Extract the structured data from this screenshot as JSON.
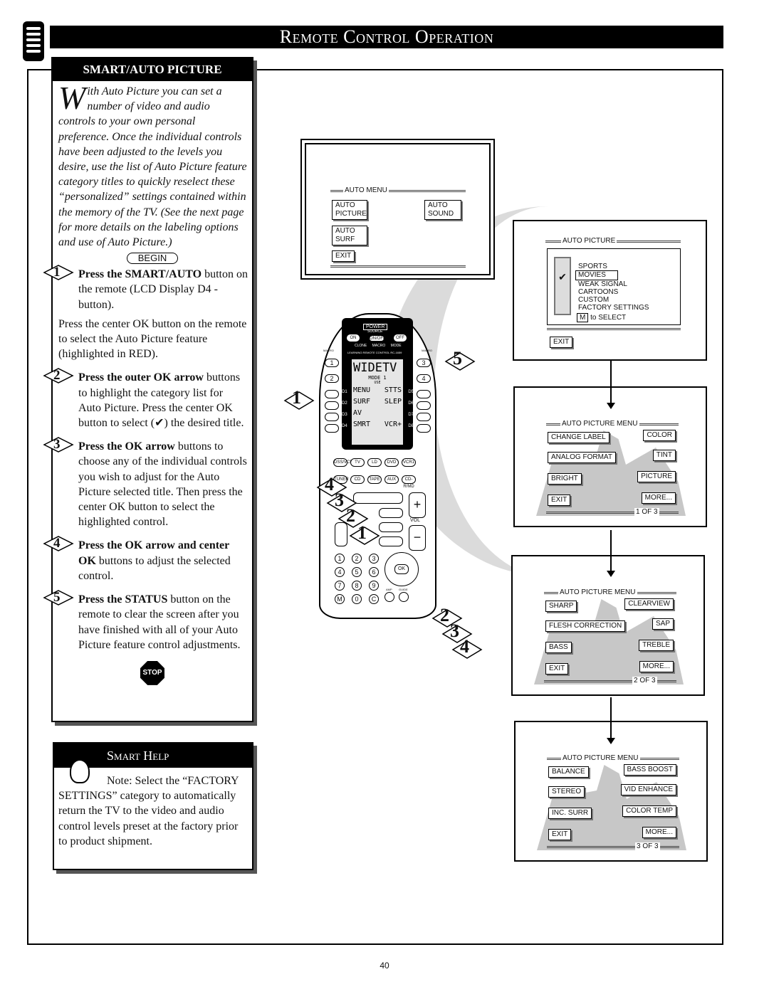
{
  "header": {
    "title": "Remote Control Operation"
  },
  "sidebar": {
    "heading": "SMART/AUTO PICTURE",
    "intro_dropcap": "W",
    "intro": "ith Auto Picture you can set a number of video and audio controls to your own personal preference. Once the individual controls have been adjusted to the levels you desire, use the list of Auto Picture feature category titles to quickly reselect these “personalized” settings contained within the memory of the TV. (See the next page for more details on the labeling options and use of Auto Picture.)",
    "begin": "BEGIN",
    "steps": [
      {
        "n": "1",
        "bold": "Press the SMART/AUTO",
        "rest": " button on the remote (LCD Display D4 - button).",
        "extra": "Press the center OK button on the remote to select the Auto Picture feature (highlighted in RED)."
      },
      {
        "n": "2",
        "bold": "Press the outer OK arrow",
        "rest": " buttons to highlight the category list for Auto Picture. Press the center OK button to select (✔) the desired title."
      },
      {
        "n": "3",
        "bold": "Press the OK arrow",
        "rest": " buttons to choose any of the individual controls you wish to adjust for the Auto Picture selected title. Then press the center OK button to select the highlighted control."
      },
      {
        "n": "4",
        "bold": "Press the OK arrow   and center OK",
        "rest": " buttons to adjust the selected control."
      },
      {
        "n": "5",
        "bold": "Press the STATUS",
        "rest": " button on the remote to clear the screen after you have finished with all of your Auto Picture feature control adjustments."
      }
    ],
    "stop": "STOP"
  },
  "smart_help": {
    "heading": "Smart Help",
    "note": "Note: Select the “FACTORY SETTINGS” category to automatically return the TV to the video and audio control levels preset at the factory prior to product shipment."
  },
  "screen1": {
    "title": "AUTO MENU",
    "items": [
      "AUTO PICTURE",
      "AUTO SOUND",
      "AUTO SURF",
      "EXIT"
    ]
  },
  "screen2": {
    "title": "AUTO PICTURE",
    "options": [
      "SPORTS",
      "MOVIES",
      "WEAK SIGNAL",
      "CARTOONS",
      "CUSTOM",
      "FACTORY SETTINGS"
    ],
    "selected": "MOVIES",
    "hint_key": "M",
    "hint": "to SELECT",
    "exit": "EXIT"
  },
  "menus": [
    {
      "title": "AUTO PICTURE MENU",
      "left": [
        "CHANGE LABEL",
        "ANALOG FORMAT",
        "BRIGHT",
        "EXIT"
      ],
      "right": [
        "COLOR",
        "TINT",
        "PICTURE",
        "MORE..."
      ],
      "page": "1  OF  3"
    },
    {
      "title": "AUTO PICTURE MENU",
      "left": [
        "SHARP",
        "FLESH CORRECTION",
        "BASS",
        "EXIT"
      ],
      "right": [
        "CLEARVIEW",
        "SAP",
        "TREBLE",
        "MORE..."
      ],
      "page": "2  OF  3"
    },
    {
      "title": "AUTO PICTURE MENU",
      "left": [
        "BALANCE",
        "STEREO",
        "INC. SURR",
        "EXIT"
      ],
      "right": [
        "BASS BOOST",
        "VID ENHANCE",
        "COLOR TEMP",
        "MORE..."
      ],
      "page": "3  OF  3"
    }
  ],
  "remote": {
    "power": "POWER",
    "on": "ON",
    "off": "OFF",
    "source": "SOURCE",
    "onoff": "ON/OFF",
    "leds": [
      "CLONE",
      "MACRO",
      "MODE"
    ],
    "brand": "LEARNING REMOTE CONTROL",
    "model": "RC-1659",
    "macro": "MACRO",
    "lcd_title": "WIDETV",
    "mode": "MODE 1",
    "use": "USE",
    "lcd_left": [
      "MENU",
      "SURF",
      "AV",
      "SMRT"
    ],
    "lcd_right": [
      "STTS",
      "SLEP",
      "",
      "VCR+"
    ],
    "dl": [
      "D1",
      "D2",
      "D3",
      "D4"
    ],
    "dr": [
      "D5",
      "D6",
      "D7",
      "D8"
    ],
    "src1": [
      "DSS/VCR2",
      "TV",
      "LD",
      "DVD",
      "VCR1"
    ],
    "src2": [
      "TUNER",
      "CD",
      "TAPE",
      "AUX",
      "CD-R/MD"
    ],
    "vol": "VOL",
    "ok": "OK",
    "digits": [
      "1",
      "2",
      "3",
      "4",
      "5",
      "6",
      "7",
      "8",
      "9",
      "M",
      "0",
      "C"
    ],
    "amp": "AMP",
    "guide": "GUIDE"
  },
  "callouts": {
    "remote_steps": [
      "1",
      "5",
      "4",
      "3",
      "2",
      "1"
    ],
    "side_steps": [
      "2",
      "3",
      "4"
    ]
  },
  "page_number": "40"
}
